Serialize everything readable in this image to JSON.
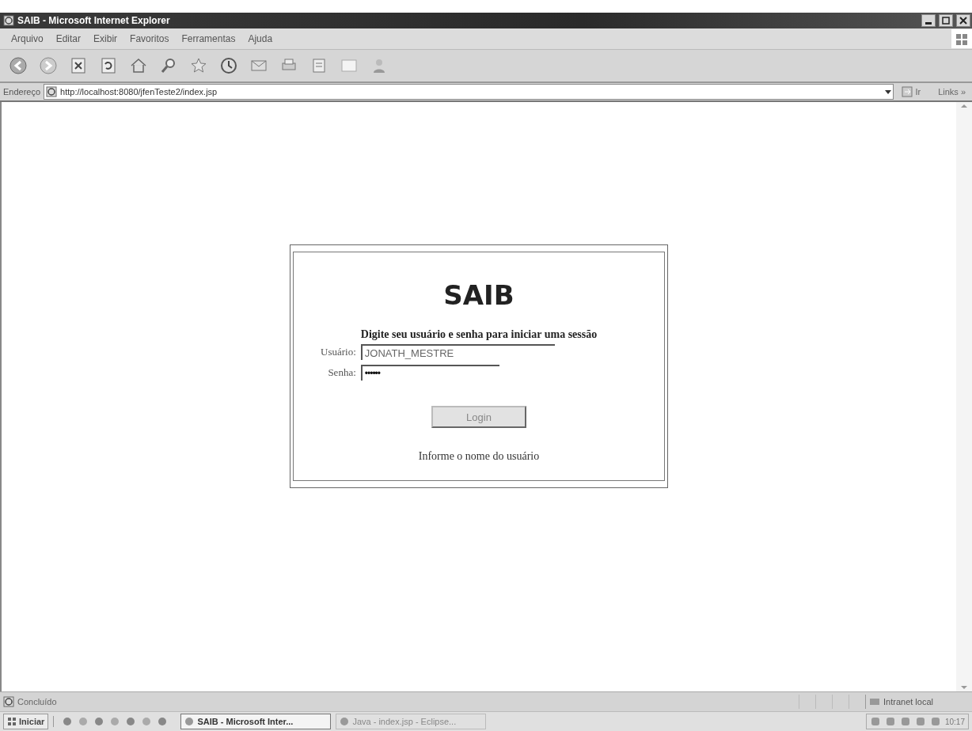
{
  "window": {
    "title": "SAIB - Microsoft Internet Explorer"
  },
  "menu": [
    "Arquivo",
    "Editar",
    "Exibir",
    "Favoritos",
    "Ferramentas",
    "Ajuda"
  ],
  "address_bar": {
    "label": "Endereço",
    "value": "http://localhost:8080/jfenTeste2/index.jsp",
    "go_button": "Ir",
    "links": "Links »"
  },
  "login": {
    "title": "SAIB",
    "prompt": "Digite seu usuário e senha para iniciar uma sessão",
    "fields": [
      {
        "label": "Usuário:",
        "value": "JONATH_MESTRE",
        "kind": "text"
      },
      {
        "label": "Senha:",
        "value": "••••••",
        "kind": "password"
      }
    ],
    "button": "Login",
    "message": "Informe o nome do usuário"
  },
  "status_bar": {
    "text": "Concluído",
    "zone": "Intranet local"
  },
  "taskbar": {
    "start": "Iniciar",
    "tasks": [
      {
        "label": "SAIB - Microsoft Inter...",
        "selected": true
      },
      {
        "label": "Java - index.jsp - Eclipse...",
        "selected": false
      }
    ],
    "clock": "10:17"
  }
}
